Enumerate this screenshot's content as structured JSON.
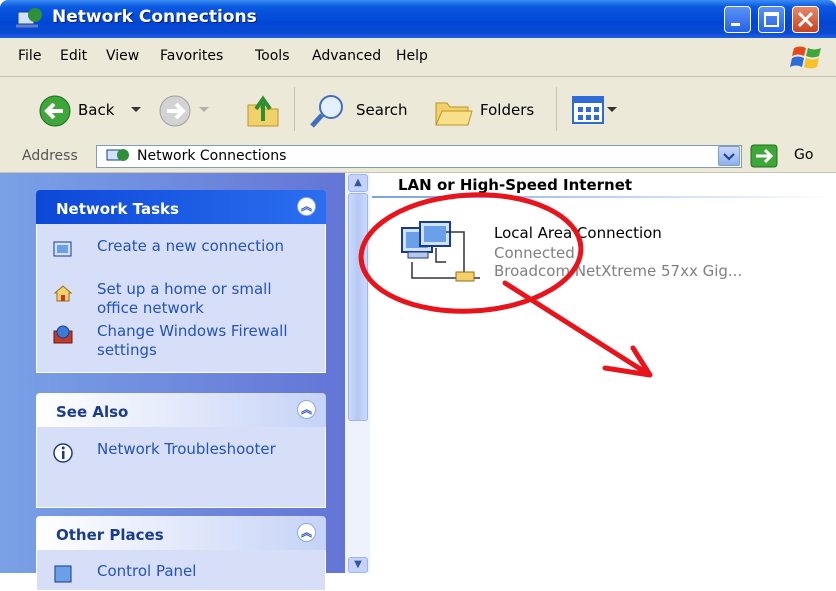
{
  "window": {
    "title": "Network Connections"
  },
  "menu": [
    "File",
    "Edit",
    "View",
    "Favorites",
    "Tools",
    "Advanced",
    "Help"
  ],
  "toolbar": {
    "back": "Back",
    "search": "Search",
    "folders": "Folders"
  },
  "address": {
    "label": "Address",
    "value": "Network Connections",
    "go": "Go"
  },
  "task_pane": {
    "network_tasks": {
      "title": "Network Tasks",
      "items": [
        "Create a new connection",
        "Set up a home or small office network",
        "Change Windows Firewall settings"
      ]
    },
    "see_also": {
      "title": "See Also",
      "items": [
        "Network Troubleshooter"
      ]
    },
    "other_places": {
      "title": "Other Places",
      "items": [
        "Control Panel"
      ]
    }
  },
  "content": {
    "section": "LAN or High-Speed Internet",
    "connection": {
      "name": "Local Area Connection",
      "status": "Connected",
      "device": "Broadcom NetXtreme 57xx Gig..."
    }
  },
  "colors": {
    "titlebar": "#0046d5",
    "task_link": "#2452b8",
    "annotation": "#e8141c"
  }
}
